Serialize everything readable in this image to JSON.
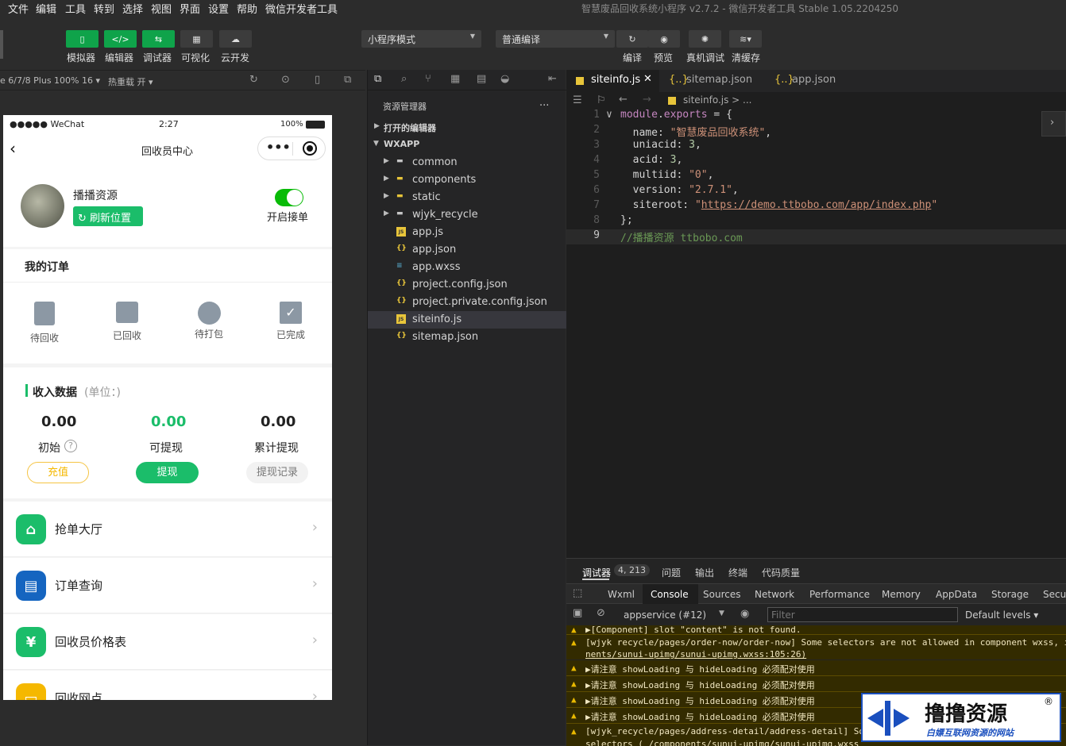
{
  "menubar": {
    "items": [
      "文件",
      "编辑",
      "工具",
      "转到",
      "选择",
      "视图",
      "界面",
      "设置",
      "帮助",
      "微信开发者工具"
    ],
    "window_title": "智慧废品回收系统小程序 v2.7.2 - 微信开发者工具 Stable 1.05.2204250"
  },
  "toolbar": {
    "left_buttons": [
      "模拟器",
      "编辑器",
      "调试器",
      "可视化",
      "云开发"
    ],
    "mode_select": "小程序模式",
    "compile_select": "普通编译",
    "right_buttons": [
      "编译",
      "预览",
      "真机调试",
      "清缓存"
    ]
  },
  "simbar": {
    "device": "e 6/7/8 Plus 100% 16",
    "hot_reload": "热重载 开"
  },
  "phone": {
    "status": {
      "carrier": "●●●●● WeChat",
      "time": "2:27",
      "battery": "100%"
    },
    "nav_title": "回收员中心",
    "profile": {
      "name": "播播资源",
      "refresh_btn": "刷新位置",
      "toggle_label": "开启接单"
    },
    "orders": {
      "title": "我的订单",
      "items": [
        {
          "label": "待回收",
          "icon": "clipboard-clock-icon"
        },
        {
          "label": "已回收",
          "icon": "box-search-icon"
        },
        {
          "label": "待打包",
          "icon": "recycle-icon"
        },
        {
          "label": "已完成",
          "icon": "check-box-icon"
        }
      ]
    },
    "income": {
      "title": "收入数据",
      "unit": "(单位：)",
      "stats": [
        {
          "value": "0.00",
          "label": "初始",
          "button": "充值"
        },
        {
          "value": "0.00",
          "label": "可提现",
          "button": "提现"
        },
        {
          "value": "0.00",
          "label": "累计提现",
          "button": "提现记录"
        }
      ]
    },
    "menu": [
      {
        "label": "抢单大厅",
        "icon": "home-icon",
        "color": "#1bbd6a"
      },
      {
        "label": "订单查询",
        "icon": "order-search-icon",
        "color": "#1565c0"
      },
      {
        "label": "回收员价格表",
        "icon": "yen-icon",
        "color": "#1bbd6a"
      },
      {
        "label": "回收网点",
        "icon": "shop-icon",
        "color": "#f5b800"
      }
    ]
  },
  "explorer": {
    "title": "资源管理器",
    "more": "...",
    "open_editors": "打开的编辑器",
    "project": "WXAPP",
    "tree": [
      {
        "name": "common",
        "type": "folder"
      },
      {
        "name": "components",
        "type": "folder-special"
      },
      {
        "name": "static",
        "type": "folder-special"
      },
      {
        "name": "wjyk_recycle",
        "type": "folder"
      },
      {
        "name": "app.js",
        "type": "js"
      },
      {
        "name": "app.json",
        "type": "json"
      },
      {
        "name": "app.wxss",
        "type": "css"
      },
      {
        "name": "project.config.json",
        "type": "json"
      },
      {
        "name": "project.private.config.json",
        "type": "json"
      },
      {
        "name": "siteinfo.js",
        "type": "js",
        "selected": true
      },
      {
        "name": "sitemap.json",
        "type": "json"
      }
    ]
  },
  "editor": {
    "tabs": [
      "siteinfo.js",
      "sitemap.json",
      "app.json"
    ],
    "breadcrumb": "siteinfo.js > ...",
    "lines": [
      [
        "module.exports = {"
      ],
      [
        "  name: \"智慧废品回收系统\","
      ],
      [
        "  uniacid: 3,"
      ],
      [
        "  acid: 3,"
      ],
      [
        "  multiid: \"0\","
      ],
      [
        "  version: \"2.7.1\","
      ],
      [
        "  siteroot: \"https://demo.ttbobo.com/app/index.php\""
      ],
      [
        "};"
      ],
      [
        "//播播资源 ttbobo.com"
      ]
    ]
  },
  "console": {
    "top_tabs": [
      "调试器",
      "4, 213",
      "问题",
      "输出",
      "终端",
      "代码质量"
    ],
    "dev_tabs": [
      "Wxml",
      "Console",
      "Sources",
      "Network",
      "Performance",
      "Memory",
      "AppData",
      "Storage",
      "Secur"
    ],
    "context": "appservice (#12)",
    "filter_placeholder": "Filter",
    "levels": "Default levels",
    "messages": [
      "▶[Component] slot \"content\" is not found.",
      "[wjyk_recycle/pages/order-now/order-now] Some selectors are not allowed in component wxss, i",
      "nents/sunui-upimg/sunui-upimg.wxss:105:26)",
      "▶请注意 showLoading 与 hideLoading 必须配对使用",
      "▶请注意 showLoading 与 hideLoading 必须配对使用",
      "▶请注意 showLoading 与 hideLoading 必须配对使用",
      "▶请注意 showLoading 与 hideLoading 必须配对使用",
      "[wjyk_recycle/pages/address-detail/address-detail] So",
      "selectors ( /components/sunui-upimg/sunui-upimg.wxss"
    ]
  },
  "watermark": {
    "title": "撸撸资源",
    "sub": "白嫖互联网资源的网站",
    "reg": "®"
  }
}
